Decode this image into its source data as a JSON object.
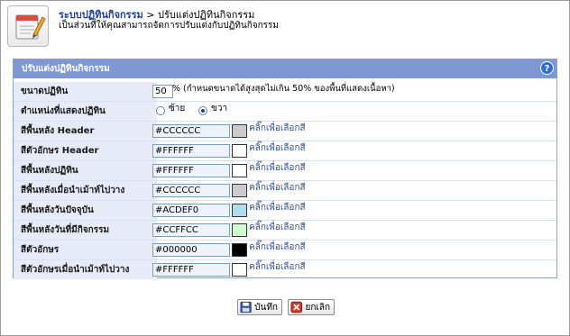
{
  "breadcrumb": {
    "root_label": "ระบบปฏิทินกิจกรรม",
    "separator": " > ",
    "current_label": "ปรับแต่งปฏิทินกิจกรรม"
  },
  "subtitle": "เป็นส่วนที่ให้คุณสามารถจัดการปรับแต่งกับปฏิทินกิจกรรม",
  "panel": {
    "title": "ปรับแต่งปฏิทินกิจกรรม",
    "help_icon": "help-icon"
  },
  "form": {
    "size": {
      "label": "ขนาดปฏิทิน",
      "value": "50",
      "note": "% (กำหนดขนาดได้สูงสุดไม่เกิน 50% ของพื้นที่แสดงเนื้อหา)"
    },
    "position": {
      "label": "ตำแหน่งที่แสดงปฏิทิน",
      "options": [
        {
          "label": "ซ้าย",
          "checked": false
        },
        {
          "label": "ขวา",
          "checked": true
        }
      ]
    },
    "pick_link_label": "คลิ๊กเพื่อเลือกสี",
    "colors": [
      {
        "label": "สีพื้นหลัง Header",
        "value": "#CCCCCC",
        "swatch": "#CCCCCC"
      },
      {
        "label": "สีตัวอักษร Header",
        "value": "#FFFFFF",
        "swatch": "#FFFFFF"
      },
      {
        "label": "สีพื้นหลังปฏิทิน",
        "value": "#FFFFFF",
        "swatch": "#FFFFFF"
      },
      {
        "label": "สีพื้นหลังเมื่อนำเม้าท์ไปวาง",
        "value": "#CCCCCC",
        "swatch": "#CCCCCC"
      },
      {
        "label": "สีพื้นหลังวันปัจจุบัน",
        "value": "#ACDEF0",
        "swatch": "#ACDEF0"
      },
      {
        "label": "สีพื้นหลังวันที่มีกิจกรรม",
        "value": "#CCFFCC",
        "swatch": "#CCFFCC"
      },
      {
        "label": "สีตัวอักษร",
        "value": "#000000",
        "swatch": "#000000"
      },
      {
        "label": "สีตัวอักษรเมื่อนำเม้าท์ไปวาง",
        "value": "#FFFFFF",
        "swatch": "#FFFFFF"
      }
    ]
  },
  "buttons": {
    "save_label": "บันทึก",
    "cancel_label": "ยกเลิก"
  },
  "theme": {
    "header_bg": "#7F98D4",
    "label_bg": "#E6EBF7",
    "link": "#2B4FA8"
  }
}
